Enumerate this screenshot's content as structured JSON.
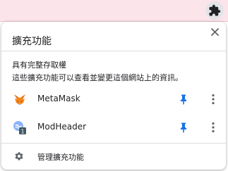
{
  "popup": {
    "title": "擴充功能",
    "access_heading": "具有完整存取權",
    "access_description": "這些擴充功能可以查看並變更這個網站上的資訊。",
    "manage_label": "管理擴充功能"
  },
  "extensions": [
    {
      "name": "MetaMask",
      "icon": "metamask-fox-icon",
      "pinned": true
    },
    {
      "name": "ModHeader",
      "icon": "modheader-icon",
      "pinned": true,
      "badge": "1"
    }
  ],
  "colors": {
    "pin": "#1a73e8",
    "topbar": "#fbe4ea",
    "text": "#202124",
    "icon": "#5f6368"
  }
}
